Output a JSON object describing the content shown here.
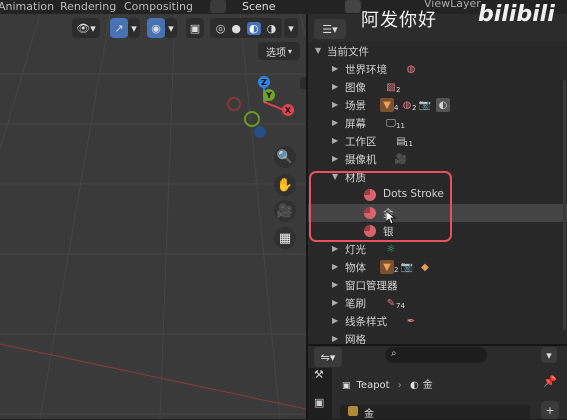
{
  "topbar": {
    "tabs": [
      "Animation",
      "Rendering",
      "Compositing"
    ],
    "scene": "Scene",
    "view_layer": "ViewLayer"
  },
  "viewport": {
    "options_label": "选项",
    "gizmo_axes": {
      "z": "Z",
      "y": "Y",
      "x": "X"
    }
  },
  "outliner": {
    "root_label": "当前文件",
    "rows": [
      {
        "label": "世界环境"
      },
      {
        "label": "图像",
        "count": "2"
      },
      {
        "label": "场景",
        "count1": "4",
        "count2": "2"
      },
      {
        "label": "屏幕",
        "count": "11"
      },
      {
        "label": "工作区",
        "count": "11"
      },
      {
        "label": "摄像机"
      },
      {
        "label": "材质"
      },
      {
        "label": "Dots Stroke"
      },
      {
        "label": "金"
      },
      {
        "label": "银"
      },
      {
        "label": "灯光"
      },
      {
        "label": "物体",
        "count": "2"
      },
      {
        "label": "窗口管理器"
      },
      {
        "label": "笔刷",
        "count": "74"
      },
      {
        "label": "线条样式"
      },
      {
        "label": "网格"
      }
    ]
  },
  "properties": {
    "object_name": "Teapot",
    "material_name": "金",
    "slot_label": "金"
  },
  "watermark": {
    "text": "阿发你好",
    "logo": "bilibili"
  },
  "colors": {
    "highlight": "#e8525d",
    "active_blue": "#4772b3",
    "axis_x": "#e0414f",
    "axis_y": "#73a324",
    "axis_z": "#2f83e3"
  }
}
